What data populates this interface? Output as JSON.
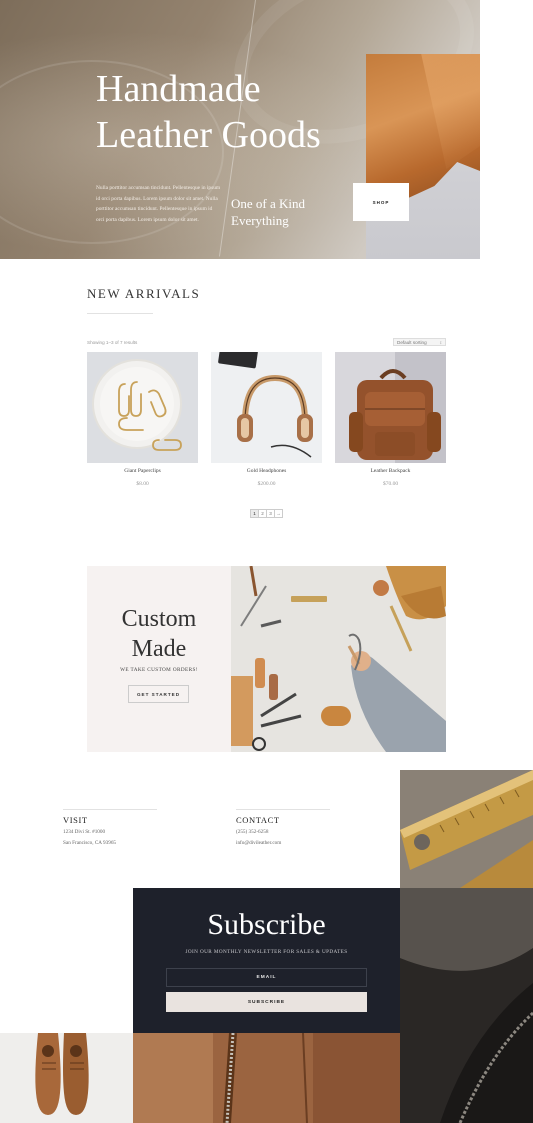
{
  "hero": {
    "title_line1": "Handmade",
    "title_line2": "Leather Goods",
    "body": "Nulla porttitor accumsan tincidunt. Pellentesque in ipsum id orci porta dapibus. Lorem ipsum dolor sit amet. Nulla porttitor accumsan tincidunt. Pellentesque in ipsum id orci porta dapibus. Lorem ipsum dolor sit amet.",
    "tagline_line1": "One of a Kind",
    "tagline_line2": "Everything",
    "shop_label": "SHOP"
  },
  "arrivals": {
    "title": "NEW ARRIVALS",
    "results": "Showing 1–3 of 7 results",
    "sort_label": "Default sorting",
    "products": [
      {
        "name": "Giant Paperclips",
        "price": "$8.00"
      },
      {
        "name": "Gold Headphones",
        "price": "$200.00"
      },
      {
        "name": "Leather Backpack",
        "price": "$70.00"
      }
    ],
    "pages": [
      "1",
      "2",
      "3",
      "→"
    ]
  },
  "custom": {
    "title_line1": "Custom",
    "title_line2": "Made",
    "subtitle": "WE TAKE CUSTOM ORDERS!",
    "button_label": "GET STARTED"
  },
  "visit": {
    "heading": "VISIT",
    "line1": "1234 Divi St. #1000",
    "line2": "San Francisco, CA 93965"
  },
  "contact": {
    "heading": "CONTACT",
    "line1": "(255) 352-6258",
    "line2": "info@divileather.com"
  },
  "subscribe": {
    "title": "Subscribe",
    "text": "JOIN OUR MONTHLY NEWSLETTER FOR SALES & UPDATES",
    "email_placeholder": "EMAIL",
    "button_label": "SUBSCRIBE"
  },
  "colors": {
    "dark_panel": "#1e212b",
    "cream": "#f6f2f1",
    "button_light": "#e9e3df"
  },
  "icons": {
    "select_caret": "↕",
    "next_page": "→"
  }
}
